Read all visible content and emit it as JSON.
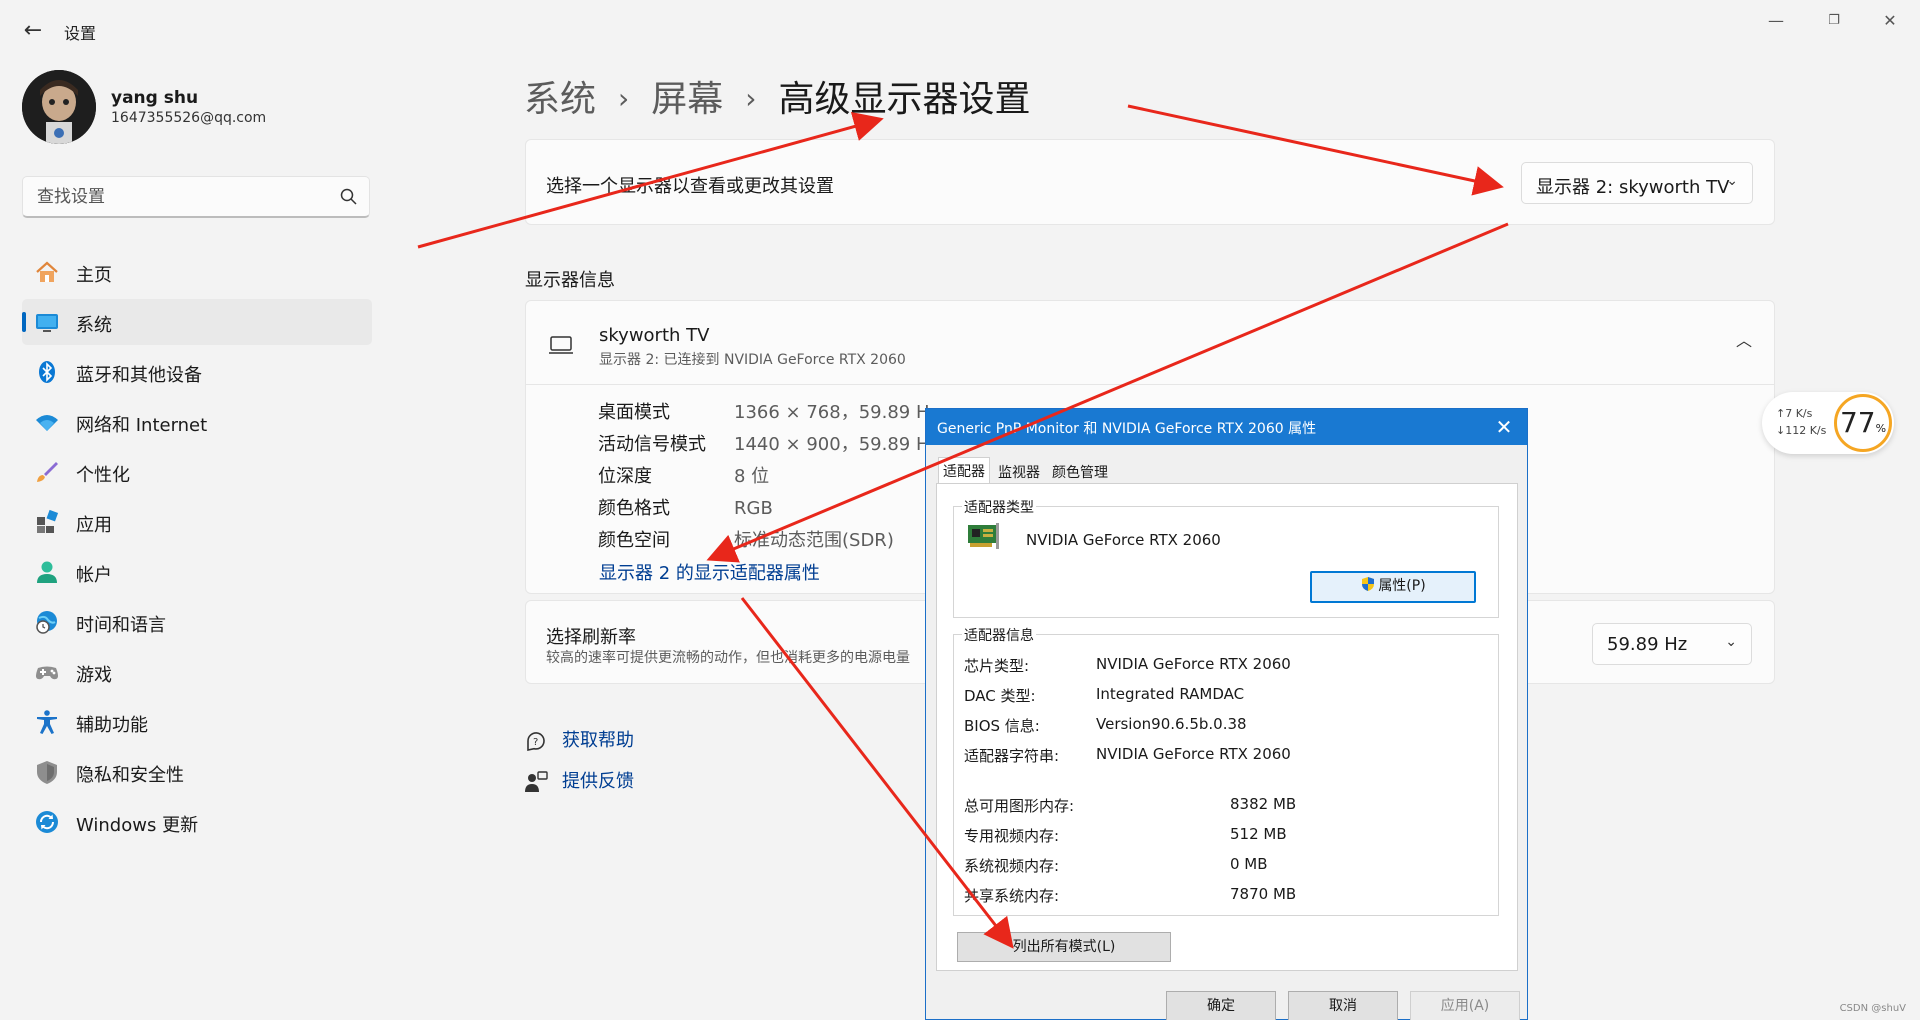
{
  "window": {
    "title": "设置",
    "back_icon": "←",
    "minimize_icon": "—",
    "restore_icon": "❐",
    "close_icon": "✕"
  },
  "user": {
    "name": "yang shu",
    "email": "1647355526@qq.com"
  },
  "search": {
    "placeholder": "查找设置"
  },
  "sidebar": {
    "items": [
      {
        "label": "主页"
      },
      {
        "label": "系统"
      },
      {
        "label": "蓝牙和其他设备"
      },
      {
        "label": "网络和 Internet"
      },
      {
        "label": "个性化"
      },
      {
        "label": "应用"
      },
      {
        "label": "帐户"
      },
      {
        "label": "时间和语言"
      },
      {
        "label": "游戏"
      },
      {
        "label": "辅助功能"
      },
      {
        "label": "隐私和安全性"
      },
      {
        "label": "Windows 更新"
      }
    ]
  },
  "breadcrumb": {
    "items": [
      "系统",
      "屏幕",
      "高级显示器设置"
    ],
    "separator": "›"
  },
  "select_display": {
    "label": "选择一个显示器以查看或更改其设置",
    "value": "显示器 2: skyworth TV",
    "chevron": "⌄"
  },
  "display_info": {
    "section_title": "显示器信息",
    "name": "skyworth TV",
    "subtitle": "显示器 2: 已连接到 NVIDIA GeForce RTX 2060",
    "collapse_icon": "︿",
    "rows": [
      {
        "label": "桌面模式",
        "value": "1366 × 768，59.89 Hz"
      },
      {
        "label": "活动信号模式",
        "value": "1440 × 900，59.89 Hz"
      },
      {
        "label": "位深度",
        "value": "8 位"
      },
      {
        "label": "颜色格式",
        "value": "RGB"
      },
      {
        "label": "颜色空间",
        "value": "标准动态范围(SDR)"
      }
    ],
    "adapter_link": "显示器 2 的显示适配器属性"
  },
  "refresh_rate": {
    "label": "选择刷新率",
    "description": "较高的速率可提供更流畅的动作，但也消耗更多的电源电量",
    "value": "59.89 Hz",
    "chevron": "⌄"
  },
  "help": {
    "get_help": "获取帮助",
    "feedback": "提供反馈"
  },
  "net_widget": {
    "up": "↑7  K/s",
    "down": "↓112 K/s",
    "percent": "77",
    "percent_sign": "%"
  },
  "dialog": {
    "title": "Generic PnP Monitor 和 NVIDIA GeForce RTX 2060 属性",
    "close_icon": "✕",
    "tabs": [
      "适配器",
      "监视器",
      "颜色管理"
    ],
    "adapter_type_title": "适配器类型",
    "adapter_name": "NVIDIA GeForce RTX 2060",
    "properties_button": "属性(P)",
    "adapter_info_title": "适配器信息",
    "info": [
      {
        "label": "芯片类型:",
        "value": "NVIDIA GeForce RTX 2060"
      },
      {
        "label": "DAC 类型:",
        "value": "Integrated RAMDAC"
      },
      {
        "label": "BIOS 信息:",
        "value": "Version90.6.5b.0.38"
      },
      {
        "label": "适配器字符串:",
        "value": "NVIDIA GeForce RTX 2060"
      }
    ],
    "memory": [
      {
        "label": "总可用图形内存:",
        "value": "8382 MB"
      },
      {
        "label": "专用视频内存:",
        "value": "512 MB"
      },
      {
        "label": "系统视频内存:",
        "value": "0 MB"
      },
      {
        "label": "共享系统内存:",
        "value": "7870 MB"
      }
    ],
    "list_modes_button": "列出所有模式(L)",
    "ok_button": "确定",
    "cancel_button": "取消",
    "apply_button": "应用(A)"
  },
  "watermark": "CSDN @shuV",
  "colors": {
    "accent": "#0067c0",
    "link": "#003e92",
    "dialog_title": "#1979d2",
    "annotation_arrow": "#e8271b"
  }
}
